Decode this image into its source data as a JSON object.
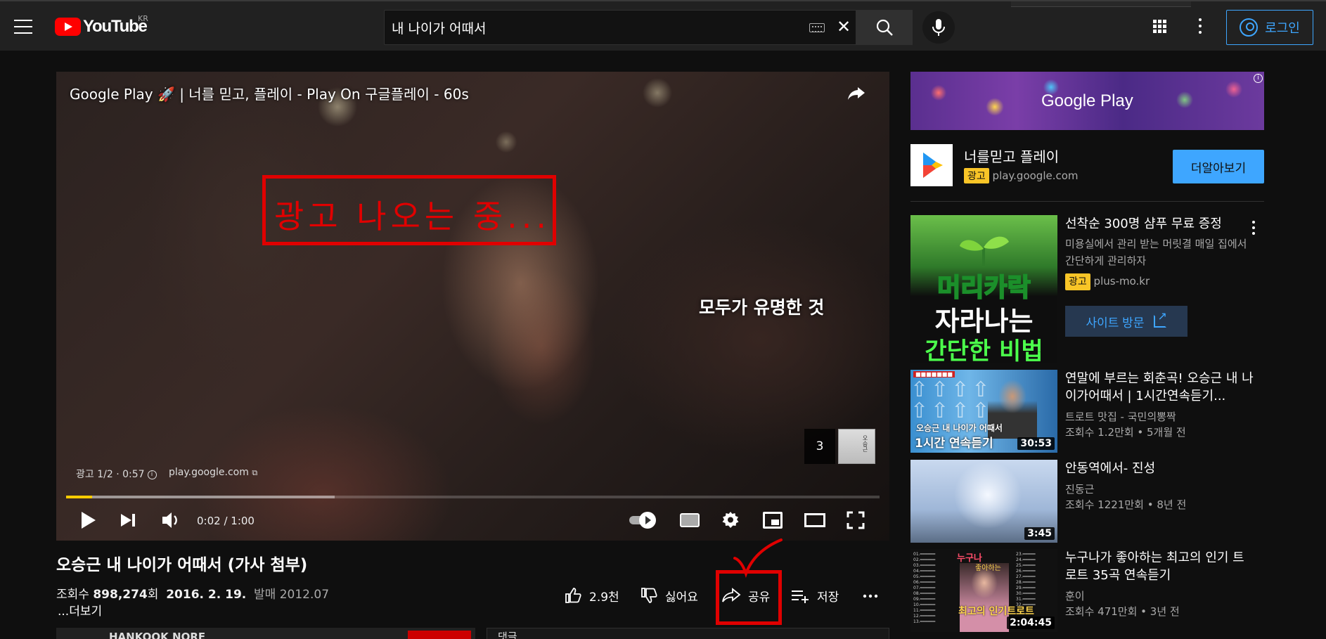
{
  "masthead": {
    "logo_text": "YouTube",
    "country_code": "KR",
    "search_value": "내 나이가 어때서",
    "login_label": "로그인"
  },
  "player": {
    "ad_title": "Google Play 🚀 | 너를 믿고, 플레이 - Play On 구글플레이 - 60s",
    "annotation_text": "광고 나오는 중...",
    "caption": "모두가 유명한 것",
    "ad_badge": "광고 1/2 · 0:57",
    "ad_domain": "play.google.com",
    "up_next_count": "3",
    "time": "0:02 / 1:00",
    "progress_played_pct": 3.2,
    "progress_buffer_pct": 33
  },
  "video": {
    "title": "오승근 내 나이가 어때서 (가사 첨부)",
    "views_prefix": "조회수",
    "views_value": "898,274",
    "views_suffix": "회",
    "date": "2016. 2. 19.",
    "release": "발매 2012.07",
    "more_label": "...더보기",
    "channel_name": "HANKOOK NORE",
    "comments_label": "댓글"
  },
  "actions": {
    "like": "2.9천",
    "dislike": "싫어요",
    "share": "공유",
    "save": "저장"
  },
  "sidebar": {
    "banner_text": "Google Play",
    "ad": {
      "app_name": "너를믿고 플레이",
      "ad_label": "광고",
      "domain": "play.google.com",
      "cta": "더알아보기"
    },
    "promo": {
      "title": "선착순 300명 샴푸 무료 증정",
      "desc": "미용실에서 관리 받는 머릿결 매일 집에서 간단하게 관리하자",
      "ad_label": "광고",
      "domain": "plus-mo.kr",
      "cta": "사이트 방문",
      "thumb_line1": "머리카락",
      "thumb_line2": "자라나는",
      "thumb_line3": "간단한 비법"
    },
    "videos": [
      {
        "title": "연말에 부르는 회춘곡! 오승근 내 나이가어때서 | 1시간연속듣기...",
        "channel": "트로트 맛집 - 국민의뽕짝",
        "meta": "조회수 1.2만회 • 5개월 전",
        "duration": "30:53",
        "thumb_caption1": "오승근 내 나이가 어때서",
        "thumb_caption2": "1시간 연속듣기"
      },
      {
        "title": "안동역에서- 진성",
        "channel": "진동근",
        "meta": "조회수 1221만회 • 8년 전",
        "duration": "3:45"
      },
      {
        "title": "누구나가 좋아하는 최고의 인기 트로트 35곡 연속듣기",
        "channel": "훈이",
        "meta": "조회수 471만회 • 3년 전",
        "duration": "2:04:45",
        "thumb_title": "누구나",
        "thumb_sub": "좋아하는",
        "thumb_bottom": "최고의 인기트로트"
      }
    ]
  },
  "colors": {
    "accent": "#3ea6ff",
    "youtube_red": "#ff0000",
    "annotation_red": "#e00000",
    "ad_yellow": "#f9c527",
    "progress_yellow": "#ffcc00"
  },
  "icons": [
    "menu-icon",
    "search-icon",
    "mic-icon",
    "apps-icon",
    "more-vert-icon",
    "account-icon",
    "keyboard-icon",
    "clear-icon",
    "share-icon",
    "play-icon",
    "next-icon",
    "volume-icon",
    "settings-icon",
    "miniplayer-icon",
    "theater-icon",
    "fullscreen-icon",
    "like-icon",
    "dislike-icon",
    "save-icon",
    "external-link-icon"
  ]
}
